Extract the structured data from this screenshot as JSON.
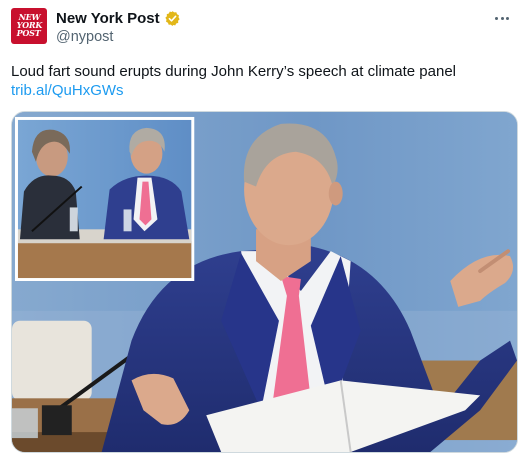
{
  "account": {
    "display_name": "New York Post",
    "handle": "@nypost",
    "avatar_text": [
      "NEW",
      "YORK",
      "POST"
    ],
    "verified": true
  },
  "tweet": {
    "text": "Loud fart sound erupts during John Kerry’s speech at climate panel",
    "link": "trib.al/QuHxGWs"
  },
  "icons": {
    "verified": "gold-verified-badge-icon",
    "more": "more-options-icon"
  },
  "colors": {
    "brand_red": "#c8102e",
    "link_blue": "#1d9bf0",
    "text_primary": "#0f1419",
    "text_secondary": "#536471",
    "verified_gold": "#e2b719"
  }
}
